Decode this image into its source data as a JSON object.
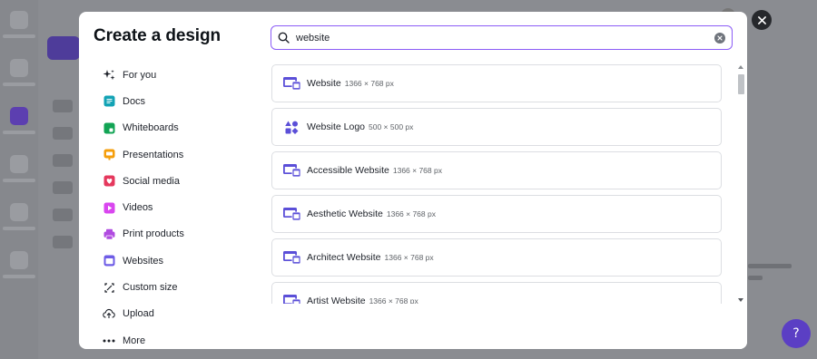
{
  "modal": {
    "title": "Create a design"
  },
  "search": {
    "value": "website",
    "placeholder": ""
  },
  "menu": [
    {
      "label": "For you",
      "icon": "sparkle-icon",
      "color": "#1d2129"
    },
    {
      "label": "Docs",
      "icon": "docs-icon",
      "color": "#13a3b5"
    },
    {
      "label": "Whiteboards",
      "icon": "whiteboard-icon",
      "color": "#12a454"
    },
    {
      "label": "Presentations",
      "icon": "presentation-icon",
      "color": "#f59e0b"
    },
    {
      "label": "Social media",
      "icon": "social-media-icon",
      "color": "#e5385d"
    },
    {
      "label": "Videos",
      "icon": "video-icon",
      "color": "#d946ef"
    },
    {
      "label": "Print products",
      "icon": "print-icon",
      "color": "#b04be0"
    },
    {
      "label": "Websites",
      "icon": "website-icon",
      "color": "#6e5ce6"
    },
    {
      "label": "Custom size",
      "icon": "custom-size-icon",
      "color": "#1d2129"
    },
    {
      "label": "Upload",
      "icon": "upload-icon",
      "color": "#1d2129"
    },
    {
      "label": "More",
      "icon": "more-icon",
      "color": "#1d2129"
    }
  ],
  "results": [
    {
      "name": "Website",
      "size": "1366 × 768 px",
      "icon": "website-icon"
    },
    {
      "name": "Website Logo",
      "size": "500 × 500 px",
      "icon": "logo-shapes-icon"
    },
    {
      "name": "Accessible Website",
      "size": "1366 × 768 px",
      "icon": "website-icon"
    },
    {
      "name": "Aesthetic Website",
      "size": "1366 × 768 px",
      "icon": "website-icon"
    },
    {
      "name": "Architect Website",
      "size": "1366 × 768 px",
      "icon": "website-icon"
    },
    {
      "name": "Artist Website",
      "size": "1366 × 768 px",
      "icon": "website-icon"
    }
  ],
  "colors": {
    "accent": "#8b5cf6",
    "result_icon": "#5b4fd8"
  }
}
